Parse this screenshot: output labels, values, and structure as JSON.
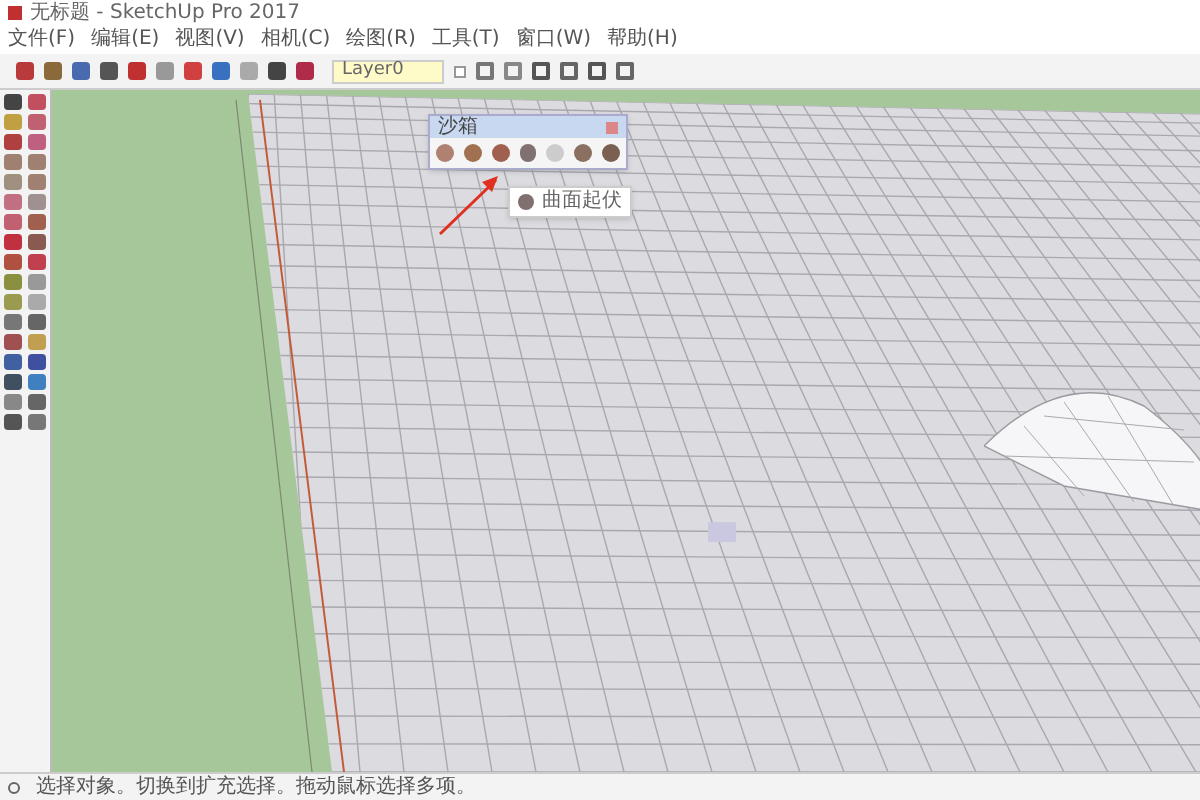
{
  "window": {
    "title": "无标题 - SketchUp Pro 2017"
  },
  "menu": [
    "文件(F)",
    "编辑(E)",
    "视图(V)",
    "相机(C)",
    "绘图(R)",
    "工具(T)",
    "窗口(W)",
    "帮助(H)"
  ],
  "layer_field": {
    "value": "Layer0"
  },
  "sandbox_toolbar": {
    "title": "沙箱",
    "tooltip": "曲面起伏"
  },
  "status_bar": {
    "text": "选择对象。切换到扩充选择。拖动鼠标选择多项。"
  }
}
